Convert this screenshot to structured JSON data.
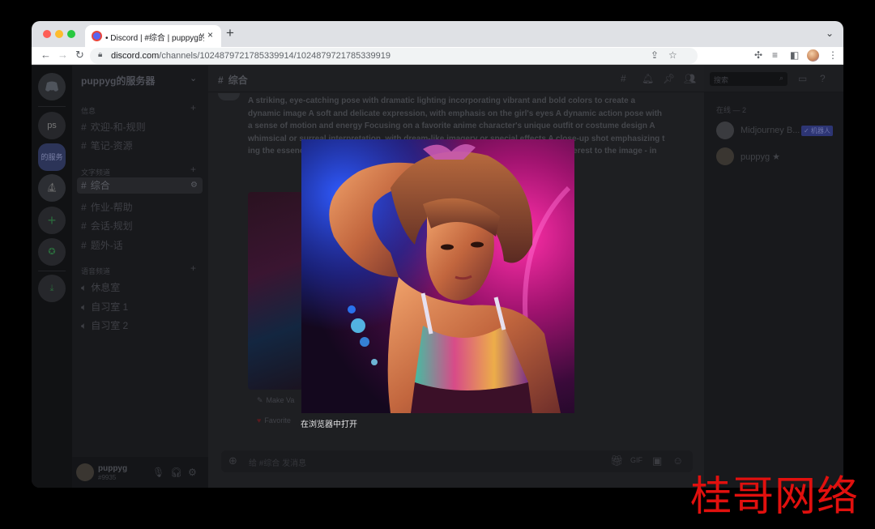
{
  "browser": {
    "tab_title": "• Discord | #综合 | puppyg的服务器",
    "tab_close": "×",
    "new_tab": "+",
    "tab_menu": "⌄",
    "url_domain": "discord.com",
    "url_path": "/channels/1024879721785339914/1024879721785339919"
  },
  "servers": {
    "items": [
      {
        "label": "ps"
      },
      {
        "label": "的服务器"
      },
      {
        "label": ""
      },
      {
        "label": "+"
      },
      {
        "label": ""
      },
      {
        "label": ""
      }
    ]
  },
  "guild": {
    "name": "puppyg的服务器",
    "categories": [
      {
        "name": "信息",
        "channels": [
          "欢迎-和-规则",
          "笔记-资源"
        ]
      },
      {
        "name": "文字频道",
        "channels": [
          "综合",
          "作业-帮助",
          "会话-规划",
          "题外-话"
        ]
      },
      {
        "name": "语音频道",
        "channels": [
          "休息室",
          "自习室 1",
          "自习室 2"
        ]
      }
    ]
  },
  "user": {
    "name": "puppyg",
    "tag": "#9935"
  },
  "main": {
    "channel_title": "综合",
    "search_placeholder": "搜索",
    "message_text": "A striking, eye-catching pose with dramatic lighting incorporating vibrant and bold colors to create a dynamic image A soft and delicate expression, with emphasis on the girl's eyes A dynamic action pose with a sense of motion and energy Focusing on a favorite anime character's unique outfit or costume design A whimsical or surreal interpretation, with dream-like imagery or special effects A close-up shot emphasizing t                                                                              ing the essence of the anime genre t                                                                             scene or setting to create mood                                                                              d depth and interest to the image - in",
    "make_variations": "Make Va",
    "favorite": "Favorite",
    "input_placeholder": "给 #综合 发消息"
  },
  "members": {
    "heading": "在线 — 2",
    "list": [
      {
        "name": "Midjourney B...",
        "badge": "✓ 机器人"
      },
      {
        "name": "puppyg ★",
        "badge": ""
      }
    ]
  },
  "lightbox": {
    "open_in_browser": "在浏览器中打开"
  },
  "watermark": {
    "text": "桂哥网络"
  },
  "colors": {
    "accent": "#5865f2",
    "watermark": "#e1100e",
    "app_bg": "#1e1f22"
  }
}
